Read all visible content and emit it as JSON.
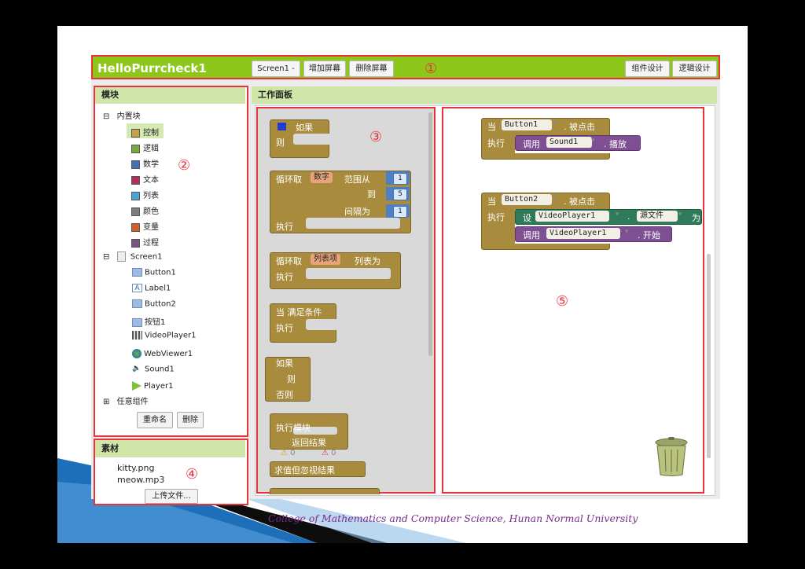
{
  "header": {
    "app_title": "HelloPurrcheck1",
    "screen_select": "Screen1 -",
    "add_screen": "增加屏幕",
    "remove_screen": "删除屏幕",
    "designer": "组件设计",
    "blocks_editor": "逻辑设计",
    "marker": "①"
  },
  "blocks_panel": {
    "title": "模块",
    "marker": "②",
    "builtin": {
      "label": "内置块",
      "toggle": "⊟",
      "items": [
        {
          "label": "控制",
          "color": "#c4a24b"
        },
        {
          "label": "逻辑",
          "color": "#77ab41"
        },
        {
          "label": "数学",
          "color": "#3f71b5"
        },
        {
          "label": "文本",
          "color": "#b32d5e"
        },
        {
          "label": "列表",
          "color": "#49a6d4"
        },
        {
          "label": "颜色",
          "color": "#7d7d7d"
        },
        {
          "label": "变量",
          "color": "#d05f2d"
        },
        {
          "label": "过程",
          "color": "#7c5385"
        }
      ]
    },
    "screen": {
      "label": "Screen1",
      "toggle": "⊟",
      "components": [
        {
          "label": "Button1",
          "icon": "button-icon"
        },
        {
          "label": "Label1",
          "icon": "label-icon"
        },
        {
          "label": "Button2",
          "icon": "button-icon"
        },
        {
          "label": "按钮1",
          "icon": "button-icon"
        },
        {
          "label": "VideoPlayer1",
          "icon": "video-icon"
        },
        {
          "label": "WebViewer1",
          "icon": "globe-icon"
        },
        {
          "label": "Sound1",
          "icon": "sound-icon"
        },
        {
          "label": "Player1",
          "icon": "play-icon"
        }
      ]
    },
    "any_component": {
      "label": "任意组件",
      "toggle": "⊞"
    },
    "rename": "重命名",
    "delete": "删除"
  },
  "media_panel": {
    "title": "素材",
    "marker": "④",
    "files": [
      "kitty.png",
      "meow.mp3"
    ],
    "upload": "上传文件..."
  },
  "workspace": {
    "title": "工作面板",
    "drawer_marker": "③",
    "canvas_marker": "⑤",
    "drawer": {
      "if_then": {
        "if": "如果",
        "then": "则"
      },
      "for_range": {
        "label": "循环取",
        "var": "数字",
        "from": "范围从",
        "to": "到",
        "by": "间隔为",
        "do": "执行",
        "v1": "1",
        "v2": "5",
        "v3": "1"
      },
      "for_each": {
        "label": "循环取",
        "var": "列表项",
        "in": "列表为",
        "do": "执行"
      },
      "while": {
        "label": "当 满足条件",
        "do": "执行"
      },
      "if_else": {
        "if": "如果",
        "then": "则",
        "else": "否则"
      },
      "do_return": {
        "do": "执行模块",
        "ret": "返回结果"
      },
      "eval_ignore": {
        "label": "求值但忽视结果"
      },
      "warn_count": "0",
      "err_count": "0"
    },
    "event1": {
      "when": "当",
      "component": "Button1",
      "event": ". 被点击",
      "do": "执行",
      "call": "调用",
      "target": "Sound1",
      "method": ". 播放"
    },
    "event2": {
      "when": "当",
      "component": "Button2",
      "event": ". 被点击",
      "do": "执行",
      "set": "设",
      "set_target": "VideoPlayer1",
      "prop": "源文件",
      "to": "为",
      "call": "调用",
      "call_target": "VideoPlayer1",
      "method": ". 开始"
    }
  },
  "footer": "College of Mathematics and Computer Science,    Hunan Normal University"
}
